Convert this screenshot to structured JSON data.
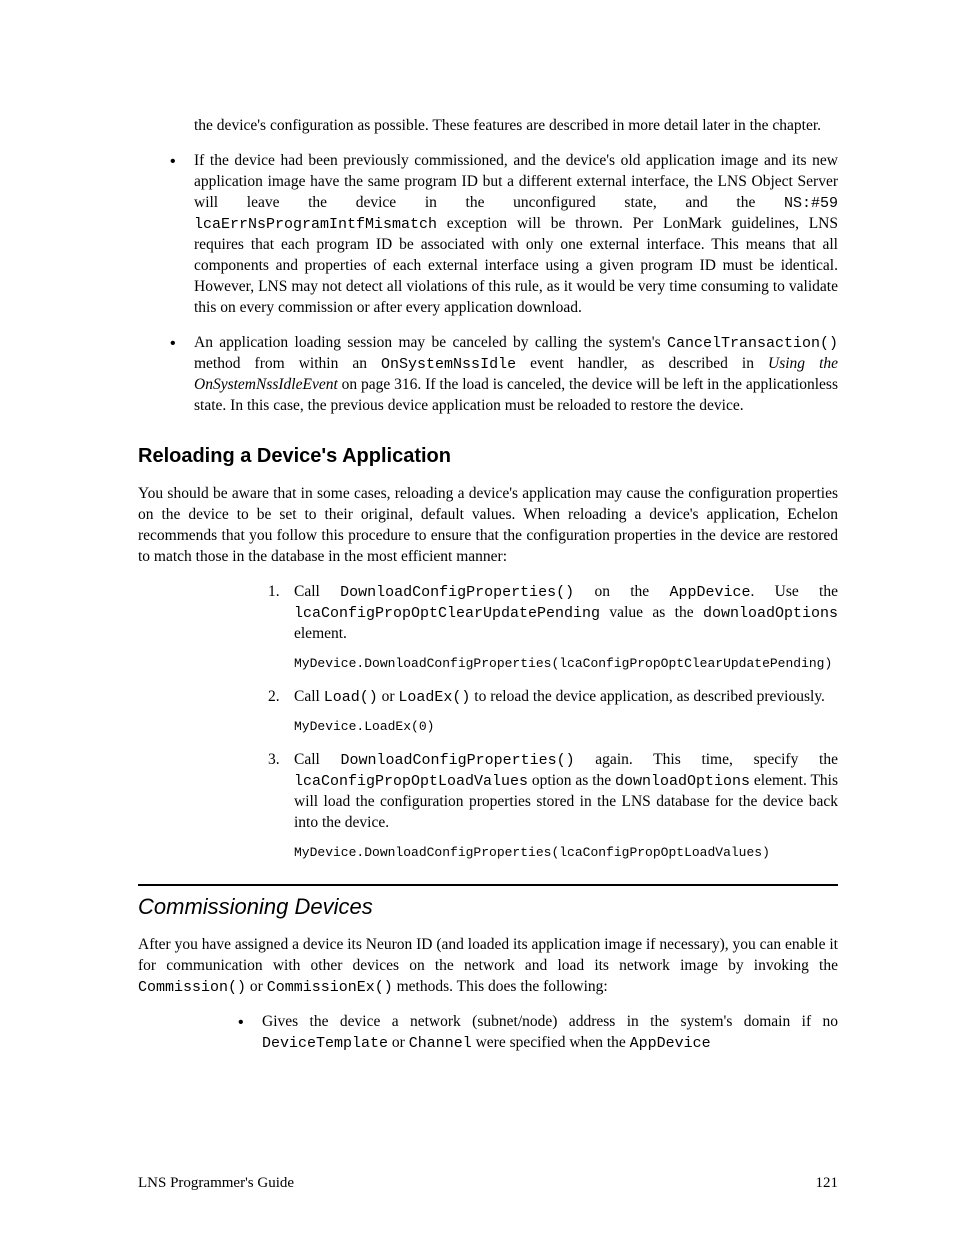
{
  "para_top": "the device's configuration as possible. These features are described in more detail later in the chapter.",
  "bullet2": {
    "a": "If the device had been previously commissioned, and the device's old application image and its new application image have the same program ID but a different external interface, the LNS Object Server will leave the device in the unconfigured state, and the ",
    "code1": "NS:#59 lcaErrNsProgramIntfMismatch",
    "b": " exception will be thrown. Per LonMark guidelines, LNS requires that each program ID be associated with only one external interface. This means that all components and properties of each external interface using a given program ID must be identical.  However, LNS may not detect all violations of this rule, as it would be very time consuming to validate this on every commission or after every application download."
  },
  "bullet3": {
    "a": "An application loading session may be canceled by calling the system's ",
    "code1": "CancelTransaction()",
    "b": " method from within an ",
    "code2": "OnSystemNssIdle",
    "c": " event handler, as described in ",
    "ital": "Using the OnSystemNssIdleEvent",
    "d": " on page 316.  If the load is canceled, the device will be left in the applicationless state. In this case, the previous device application must be reloaded to restore the device."
  },
  "h2_reload": "Reloading a Device's Application",
  "para_reload": "You should be aware that in some cases, reloading a device's application may cause the configuration properties on the device to be set to their original, default values. When reloading a device's application, Echelon recommends that you follow this procedure to ensure that the configuration properties in the device are restored to match those in the database in the most efficient manner:",
  "step1": {
    "num": "1.",
    "a": "Call ",
    "code1": "DownloadConfigProperties()",
    "b": " on the ",
    "code2": "AppDevice",
    "c": ". Use the ",
    "code3": "lcaConfigPropOptClearUpdatePending",
    "d": " value as the ",
    "code4": "downloadOptions",
    "e": " element.",
    "code_line": "MyDevice.DownloadConfigProperties(lcaConfigPropOptClearUpdatePending)"
  },
  "step2": {
    "num": "2.",
    "a": "Call ",
    "code1": "Load()",
    "b": " or ",
    "code2": "LoadEx()",
    "c": " to reload the device application, as described previously.",
    "code_line": "MyDevice.LoadEx(0)"
  },
  "step3": {
    "num": "3.",
    "a": "Call ",
    "code1": "DownloadConfigProperties()",
    "b": " again. This time, specify the ",
    "code2": "lcaConfigPropOptLoadValues",
    "c": " option as the ",
    "code3": "downloadOptions",
    "d": " element. This will load the configuration properties stored in the LNS database for the device back into the device.",
    "code_line": "MyDevice.DownloadConfigProperties(lcaConfigPropOptLoadValues)"
  },
  "h2_comm": "Commissioning Devices",
  "para_comm": {
    "a": "After you have assigned a device its Neuron ID (and loaded its application image if necessary), you can enable it for communication with other devices on the network and load its network image by invoking the ",
    "code1": "Commission()",
    "b": " or ",
    "code2": "CommissionEx()",
    "c": " methods. This does the following:"
  },
  "comm_bullet": {
    "a": "Gives the device a network  (subnet/node) address in the system's domain if no ",
    "code1": "DeviceTemplate",
    "b": " or ",
    "code2": "Channel",
    "c": " were specified when the ",
    "code3": "AppDevice"
  },
  "footer_left": "LNS Programmer's Guide",
  "footer_right": "121"
}
